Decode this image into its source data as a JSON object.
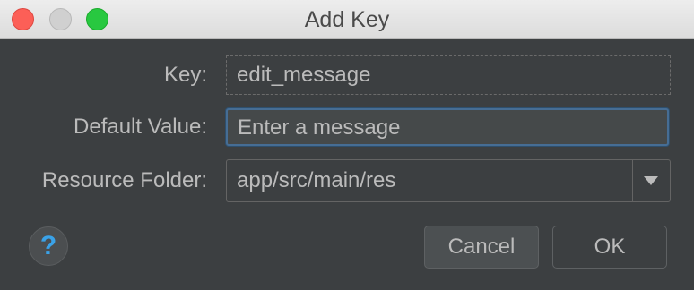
{
  "window": {
    "title": "Add Key"
  },
  "form": {
    "key_label": "Key:",
    "key_value": "edit_message",
    "default_label": "Default Value:",
    "default_value": "Enter a message",
    "folder_label": "Resource Folder:",
    "folder_value": "app/src/main/res"
  },
  "buttons": {
    "help_label": "?",
    "cancel_label": "Cancel",
    "ok_label": "OK"
  },
  "icons": {
    "close": "close-traffic-light-icon",
    "minimize": "minimize-traffic-light-icon",
    "maximize": "maximize-traffic-light-icon",
    "dropdown": "chevron-down-icon",
    "help": "help-icon"
  },
  "colors": {
    "background": "#3c3f41",
    "text": "#bbbbbb",
    "focus_border": "#466d94",
    "help_accent": "#3aa2e8",
    "close": "#fc5f57",
    "maximize": "#28c840"
  }
}
